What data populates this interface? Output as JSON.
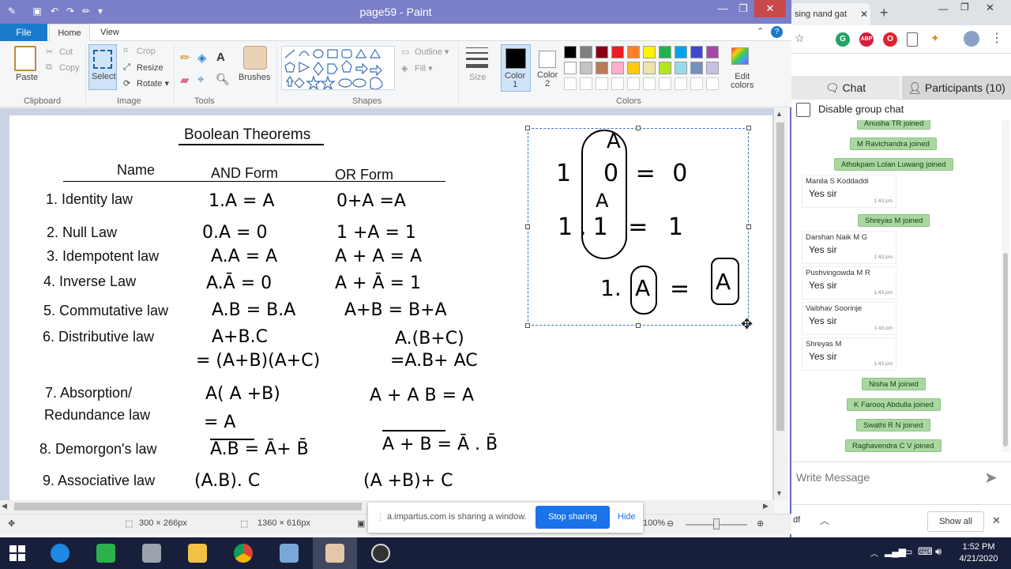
{
  "paint": {
    "title": "page59 - Paint",
    "menu": {
      "file": "File",
      "home": "Home",
      "view": "View"
    },
    "ribbon": {
      "clipboard": {
        "paste": "Paste",
        "cut": "Cut",
        "copy": "Copy",
        "label": "Clipboard"
      },
      "image": {
        "select": "Select",
        "crop": "Crop",
        "resize": "Resize",
        "rotate": "Rotate",
        "label": "Image"
      },
      "tools": {
        "label": "Tools"
      },
      "brushes": "Brushes",
      "shapes": {
        "outline": "Outline",
        "fill": "Fill",
        "label": "Shapes"
      },
      "size": "Size",
      "color1": "Color\n1",
      "color2": "Color\n2",
      "edit_colors": "Edit\ncolors",
      "colors_label": "Colors",
      "palette": [
        "#000000",
        "#7f7f7f",
        "#880015",
        "#ed1c24",
        "#ff7f27",
        "#fff200",
        "#22b14c",
        "#00a2e8",
        "#3f48cc",
        "#a349a4",
        "#ffffff",
        "#c3c3c3",
        "#b97a57",
        "#ffaec9",
        "#ffc90e",
        "#efe4b0",
        "#b5e61d",
        "#99d9ea",
        "#7092be",
        "#c8bfe7"
      ]
    },
    "status": {
      "selection_size": "300 × 266px",
      "image_size": "1360 × 616px",
      "zoom": "100%"
    },
    "board": {
      "title": "Boolean Theorems",
      "headers": {
        "name": "Name",
        "and": "AND Form",
        "or": "OR Form"
      },
      "laws": [
        {
          "name": "1. Identity law",
          "and": "1.A = A",
          "or": "0+A =A"
        },
        {
          "name": "2. Null Law",
          "and": "0.A = 0",
          "or": "1 +A = 1"
        },
        {
          "name": "3. Idempotent law",
          "and": "A.A = A",
          "or": "A + A = A"
        },
        {
          "name": "4. Inverse Law",
          "and": "A.Ā = 0",
          "or": "A + Ā = 1"
        },
        {
          "name": "5. Commutative law",
          "and": "A.B = B.A",
          "or": "A+B = B+A"
        },
        {
          "name": "6. Distributive law",
          "and": "A+B.C",
          "or": "A.(B+C)"
        },
        {
          "name": "7. Absorption/",
          "and": "A( A +B)",
          "or": "A + A B = A"
        },
        {
          "name": "8. Demorgon's law",
          "and": "A.B = Ā+ B̄",
          "or": "A + B = Ā . B̄"
        },
        {
          "name": "9. Associative law",
          "and": "(A.B). C",
          "or": "(A +B)+ C"
        }
      ],
      "law7_line2": "Redundance law",
      "distributive_and_2": "= (A+B)(A+C)",
      "distributive_or_2": "=A.B+ AC",
      "absorption_and_2": "= A",
      "sketch": {
        "l1": "1",
        "l1b": "0 = 0",
        "l2": "A",
        "l3": "1.1 = 1",
        "l4a": "1.",
        "l4b": "A",
        "l4c": "=",
        "l4d": "A"
      }
    }
  },
  "browser": {
    "tab_title": "sing nand gat",
    "chat_tab": "Chat",
    "participants_tab": "Participants (10)",
    "disable_chat": "Disable group chat",
    "messages": [
      {
        "kind": "notice",
        "text": "Anusha TR joined"
      },
      {
        "kind": "notice",
        "text": "M Ravichandra  joined"
      },
      {
        "kind": "notice",
        "text": "Athokpam Lolan Luwang  joined"
      },
      {
        "kind": "msg",
        "who": "Manila S Koddaddi",
        "text": "Yes sir",
        "time": "1:43 pm"
      },
      {
        "kind": "notice",
        "text": "Shreyas M  joined"
      },
      {
        "kind": "msg",
        "who": "Darshan Naik M G",
        "text": "Yes sir",
        "time": "1:43 pm"
      },
      {
        "kind": "msg",
        "who": "Pushvingowda M R",
        "text": "Yes sir",
        "time": "1:43 pm"
      },
      {
        "kind": "msg",
        "who": "Vaibhav Soorinje",
        "text": "Yes sir",
        "time": "1:43 pm"
      },
      {
        "kind": "msg",
        "who": "Shreyas M",
        "text": "Yes sir",
        "time": "1:43 pm"
      },
      {
        "kind": "notice",
        "text": "Nisha M  joined"
      },
      {
        "kind": "notice",
        "text": "K Farooq Abdulla  joined"
      },
      {
        "kind": "notice",
        "text": "Swathi R N  joined"
      },
      {
        "kind": "notice",
        "text": "Raghavendra C V  joined"
      }
    ],
    "write_placeholder": "Write Message",
    "download_file": "df",
    "show_all": "Show all"
  },
  "share": {
    "text": "a.impartus.com is sharing a window.",
    "stop": "Stop sharing",
    "hide": "Hide"
  },
  "taskbar": {
    "time": "1:52 PM",
    "date": "4/21/2020"
  }
}
